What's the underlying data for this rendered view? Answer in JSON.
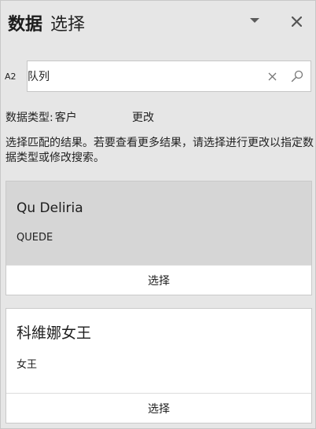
{
  "header": {
    "title_bold": "数据",
    "title_light": "选择",
    "dropdown_icon": "chevron-down-icon",
    "close_icon": "close-icon"
  },
  "search": {
    "prefix": "A2",
    "value": "队列",
    "clear_icon": "clear-icon",
    "search_icon": "search-icon"
  },
  "data_type": {
    "label": "数据类型:",
    "value": "客户",
    "change_label": "更改"
  },
  "description": "选择匹配的结果。若要查看更多结果，请选择进行更改以指定数据类型或修改搜索。",
  "results": [
    {
      "title": "Qu Deliria",
      "subtitle": "QUEDE",
      "select_label": "选择"
    },
    {
      "title": "科維娜女王",
      "subtitle": "女王",
      "select_label": "选择"
    }
  ]
}
